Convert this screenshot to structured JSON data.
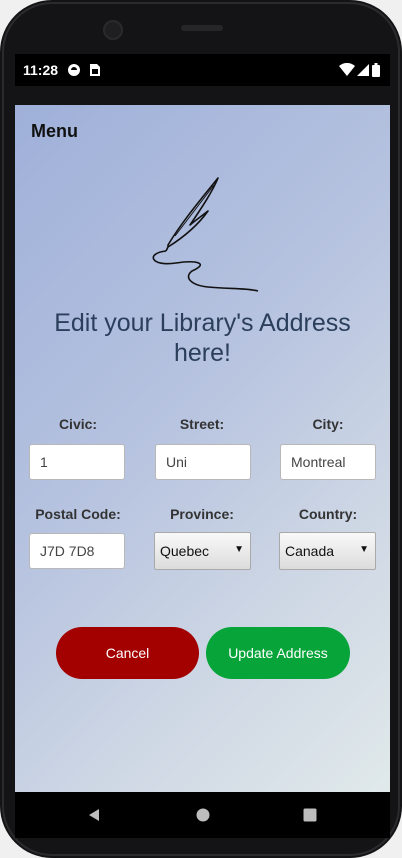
{
  "status_bar": {
    "time": "11:28",
    "left_icons": [
      "notification-icon",
      "sim-card-icon"
    ],
    "right_icons": [
      "wifi-icon",
      "cell-signal-icon",
      "battery-icon"
    ]
  },
  "menu_label": "Menu",
  "title_line1": "Edit your Library's Address",
  "title_line2": "here!",
  "form": {
    "civic": {
      "label": "Civic:",
      "value": "1"
    },
    "street": {
      "label": "Street:",
      "value": "Uni"
    },
    "city": {
      "label": "City:",
      "value": "Montreal"
    },
    "postal_code": {
      "label": "Postal Code:",
      "value": "J7D 7D8"
    },
    "province": {
      "label": "Province:",
      "selected": "Quebec"
    },
    "country": {
      "label": "Country:",
      "selected": "Canada"
    }
  },
  "buttons": {
    "cancel": "Cancel",
    "update": "Update Address"
  },
  "colors": {
    "cancel": "#a30000",
    "update": "#07a43a",
    "title": "#2b3f5c"
  },
  "nav_bar": [
    "back-icon",
    "home-icon",
    "recents-icon"
  ]
}
